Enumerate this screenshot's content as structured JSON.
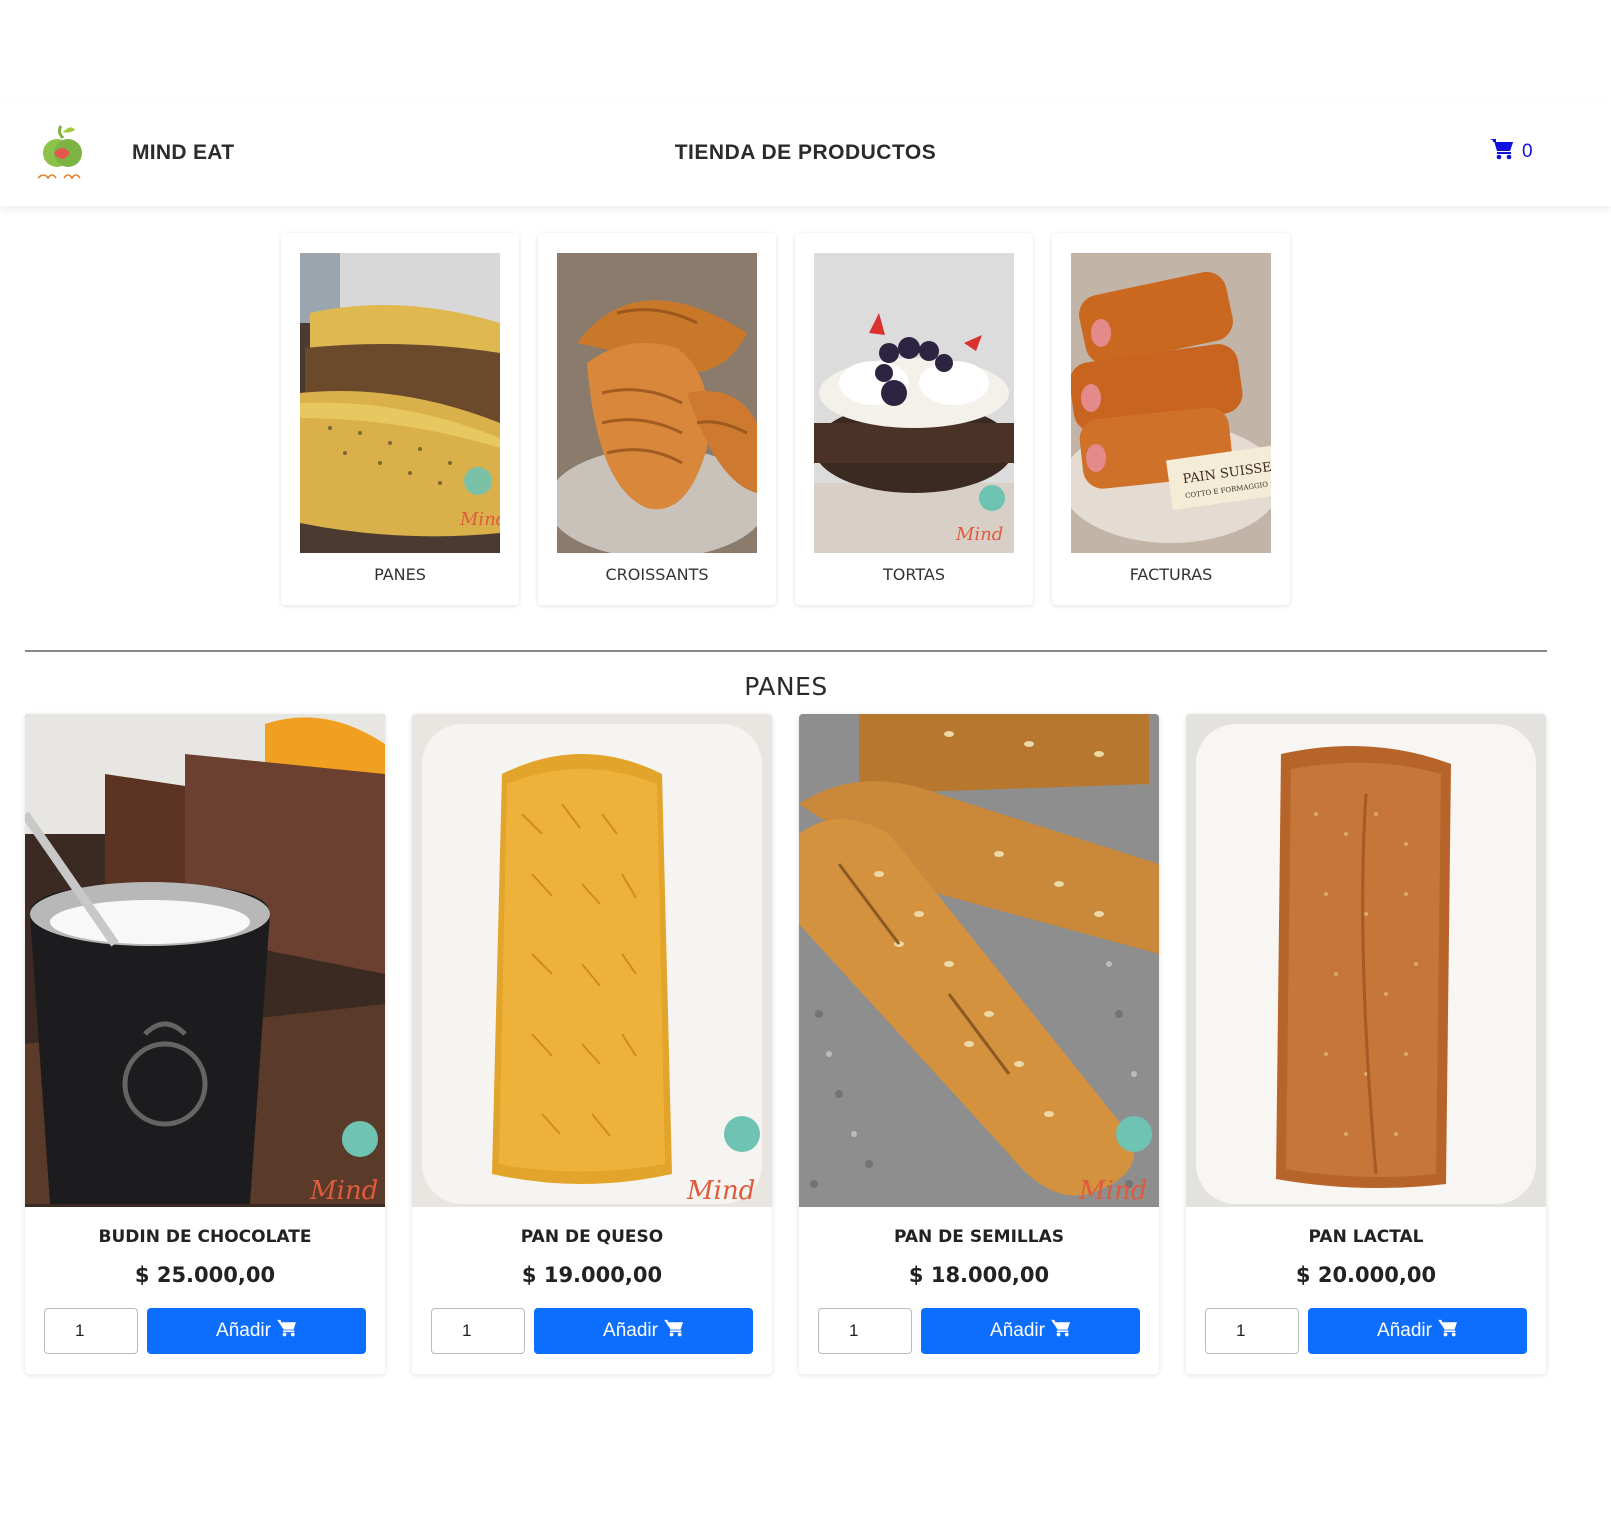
{
  "header": {
    "brand": "MIND EAT",
    "title": "TIENDA DE PRODUCTOS",
    "cart_count": "0",
    "logo_text": "Mind Eat"
  },
  "categories": [
    {
      "label": "PANES",
      "image": "panes-photo"
    },
    {
      "label": "CROISSANTS",
      "image": "croissants-photo"
    },
    {
      "label": "TORTAS",
      "image": "tortas-photo"
    },
    {
      "label": "FACTURAS",
      "image": "facturas-photo"
    }
  ],
  "section": {
    "title": "PANES"
  },
  "products": [
    {
      "name": "BUDIN DE CHOCOLATE",
      "price": "$ 25.000,00",
      "qty": "1",
      "button": "Añadir"
    },
    {
      "name": "PAN DE QUESO",
      "price": "$ 19.000,00",
      "qty": "1",
      "button": "Añadir"
    },
    {
      "name": "PAN DE SEMILLAS",
      "price": "$ 18.000,00",
      "qty": "1",
      "button": "Añadir"
    },
    {
      "name": "PAN LACTAL",
      "price": "$ 20.000,00",
      "qty": "1",
      "button": "Añadir"
    }
  ],
  "colors": {
    "accent": "#0d6efd",
    "cart_icon": "#1111dd"
  }
}
